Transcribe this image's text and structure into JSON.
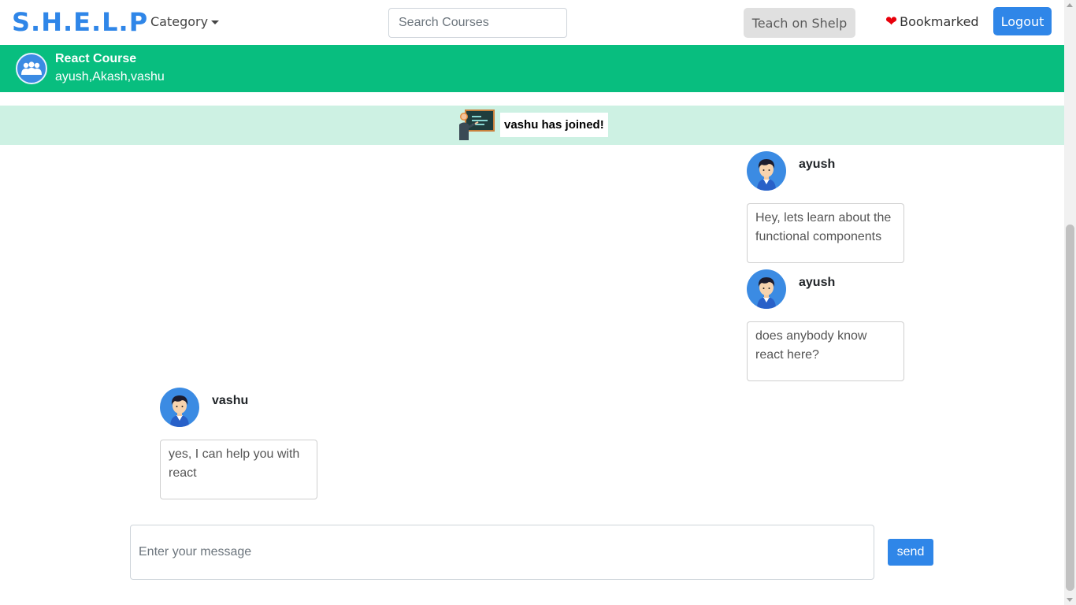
{
  "navbar": {
    "brand": "S.H.E.L.P",
    "category_label": "Category",
    "search_placeholder": "Search Courses",
    "teach_label": "Teach on Shelp",
    "bookmarked_label": "Bookmarked",
    "logout_label": "Logout"
  },
  "room": {
    "title": "React Course",
    "members": "ayush,Akash,vashu",
    "icon": "group-icon"
  },
  "join_banner": {
    "text": "vashu has joined!",
    "icon": "teacher-blackboard-icon"
  },
  "messages": [
    {
      "name": "ayush",
      "text": "Hey, lets learn about the functional components",
      "side": "right"
    },
    {
      "name": "ayush",
      "text": "does anybody know react here?",
      "side": "right"
    },
    {
      "name": "vashu",
      "text": "yes, I can help you with react",
      "side": "left"
    }
  ],
  "composer": {
    "placeholder": "Enter your message",
    "send_label": "send"
  },
  "colors": {
    "brand": "#2f86e8",
    "room_header": "#08be7f",
    "join_banner": "#cdf1e3",
    "heart": "#e8000b"
  }
}
